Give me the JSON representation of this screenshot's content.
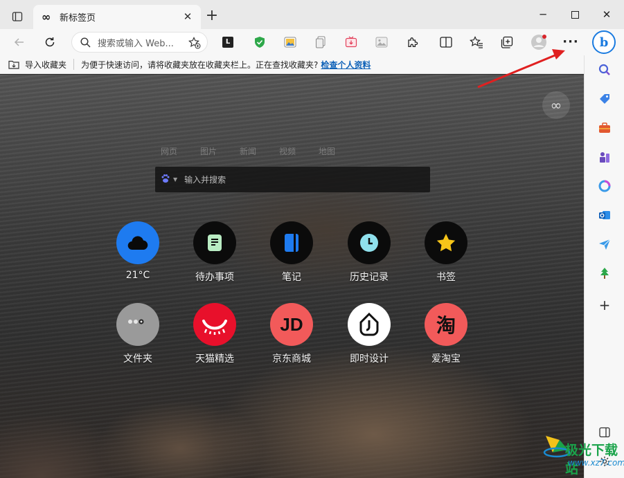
{
  "tab": {
    "title": "新标签页",
    "icon": "infinity-icon"
  },
  "address": {
    "placeholder": "搜索或输入 Web..."
  },
  "favorites_bar": {
    "import_label": "导入收藏夹",
    "hint": "为便于快速访问，请将收藏夹放在收藏夹栏上。正在查找收藏夹?",
    "link": "检查个人资料"
  },
  "newtab": {
    "search_tabs": [
      "网页",
      "图片",
      "新闻",
      "视频",
      "地图"
    ],
    "search_placeholder": "输入并搜索",
    "tiles_row1": [
      {
        "label": "21°C",
        "icon": "cloud-icon",
        "color": "#1e7bf0"
      },
      {
        "label": "待办事项",
        "icon": "note-icon",
        "color": "#0b0b0b"
      },
      {
        "label": "笔记",
        "icon": "notebook-icon",
        "color": "#0b0b0b"
      },
      {
        "label": "历史记录",
        "icon": "clock-icon",
        "color": "#0b0b0b"
      },
      {
        "label": "书签",
        "icon": "star-icon",
        "color": "#0b0b0b"
      }
    ],
    "tiles_row2": [
      {
        "label": "文件夹",
        "icon": "folder-icon",
        "color": "#9a9a9a"
      },
      {
        "label": "天猫精选",
        "icon": "tmall-icon",
        "color": "#e8102b"
      },
      {
        "label": "京东商城",
        "icon": "jd-icon",
        "color": "#f25a5a",
        "glyph": "JD"
      },
      {
        "label": "即时设计",
        "icon": "jsdesign-icon",
        "color": "#ffffff"
      },
      {
        "label": "爱淘宝",
        "icon": "taobao-icon",
        "color": "#f25a5a",
        "glyph": "淘"
      }
    ]
  },
  "watermark": {
    "text": "极光下载站",
    "url": "www.xz7.com"
  },
  "colors": {
    "arrow": "#e02020",
    "link": "#0f62b8",
    "bing": "#1a7be0"
  }
}
